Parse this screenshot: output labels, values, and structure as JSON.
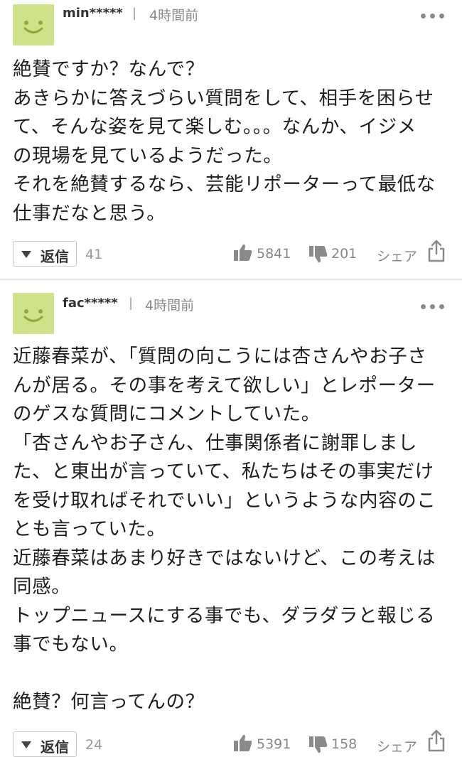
{
  "comments": [
    {
      "username": "min*****",
      "separator": "|",
      "time": "4時間前",
      "lines": [
        "絶賛ですか？なんで？",
        "あきらかに答えづらい質問をして、相手を困らせ",
        "て、そんな姿を見て楽しむ。。。なんか、イジメ",
        "の現場を見ているようだった。",
        "それを絶賛するなら、芸能リポーターって最低な",
        "仕事だなと思う。"
      ],
      "reply_label": "返信",
      "reply_count": "41",
      "likes": "5841",
      "dislikes": "201",
      "share_label": "シェア"
    },
    {
      "username": "fac*****",
      "separator": "|",
      "time": "4時間前",
      "lines": [
        "近藤春菜が、「質問の向こうには杏さんやお子さ",
        "んが居る。その事を考えて欲しい」とレポーター",
        "のゲスな質問にコメントしていた。",
        "「杏さんやお子さん、仕事関係者に謝罪しまし",
        "た、と東出が言っていて、私たちはその事実だけ",
        "を受け取ればそれでいい」というような内容のこ",
        "とも言っていた。",
        "近藤春菜はあまり好きではないけど、この考えは",
        "同感。",
        "トップニュースにする事でも、ダラダラと報じる",
        "事でもない。",
        "",
        "絶賛？何言ってんの？"
      ],
      "reply_label": "返信",
      "reply_count": "24",
      "likes": "5391",
      "dislikes": "158",
      "share_label": "シェア"
    }
  ],
  "icons": {
    "avatar": "smiley-avatar-icon",
    "more": "more-dots-icon",
    "reply": "triangle-down-icon",
    "like": "thumbs-up-icon",
    "dislike": "thumbs-down-icon",
    "share": "share-icon"
  },
  "colors": {
    "avatar_bg": "#cfe28a",
    "avatar_face": "#8fa83c",
    "muted_text": "#8a8a8a",
    "divider": "#e4e4e4"
  }
}
